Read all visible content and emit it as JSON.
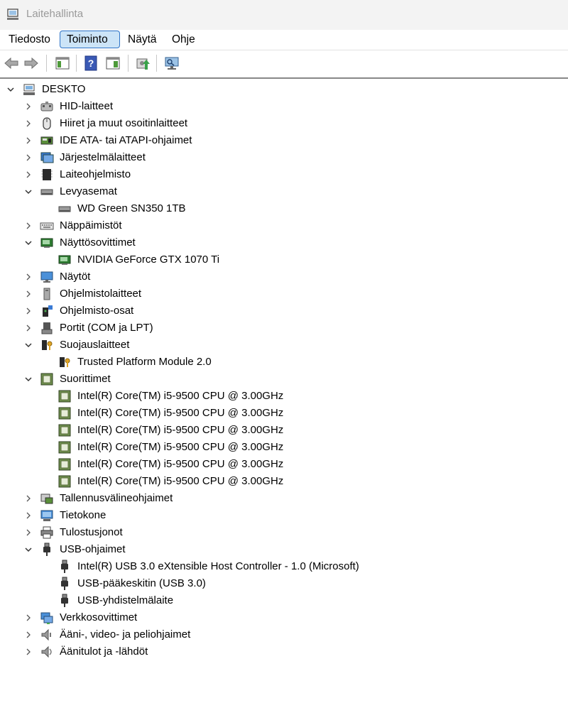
{
  "window": {
    "title": "Laitehallinta"
  },
  "menu": [
    {
      "label": "Tiedosto",
      "active": false
    },
    {
      "label": "Toiminto",
      "active": true
    },
    {
      "label": "Näytä",
      "active": false
    },
    {
      "label": "Ohje",
      "active": false
    }
  ],
  "toolbar": [
    {
      "name": "back-button",
      "icon": "arrow-left-icon"
    },
    {
      "name": "forward-button",
      "icon": "arrow-right-icon"
    },
    {
      "name": "show-hide-console-tree-button",
      "icon": "console-tree-icon"
    },
    {
      "name": "help-button",
      "icon": "help-icon"
    },
    {
      "name": "properties-button",
      "icon": "properties-icon"
    },
    {
      "name": "update-driver-button",
      "icon": "update-driver-icon"
    },
    {
      "name": "scan-hardware-button",
      "icon": "scan-monitor-icon"
    }
  ],
  "tree": {
    "root": {
      "label": "DESKTOP",
      "expanded": true
    },
    "items": [
      {
        "label": "HID-laitteet",
        "level": 1,
        "expanded": false,
        "icon": "hid-icon"
      },
      {
        "label": "Hiiret ja muut osoitinlaitteet",
        "level": 1,
        "expanded": false,
        "icon": "mouse-icon"
      },
      {
        "label": "IDE ATA- tai ATAPI-ohjaimet",
        "level": 1,
        "expanded": false,
        "icon": "ide-controller-icon"
      },
      {
        "label": "Järjestelmälaitteet",
        "level": 1,
        "expanded": false,
        "icon": "system-devices-icon"
      },
      {
        "label": "Laiteohjelmisto",
        "level": 1,
        "expanded": false,
        "icon": "firmware-icon"
      },
      {
        "label": "Levyasemat",
        "level": 1,
        "expanded": true,
        "icon": "disk-drive-icon"
      },
      {
        "label": "WD Green SN350 1TB",
        "level": 2,
        "icon": "disk-drive-icon"
      },
      {
        "label": "Näppäimistöt",
        "level": 1,
        "expanded": false,
        "icon": "keyboard-icon"
      },
      {
        "label": "Näyttösovittimet",
        "level": 1,
        "expanded": true,
        "icon": "display-adapter-icon"
      },
      {
        "label": "NVIDIA GeForce GTX 1070 Ti",
        "level": 2,
        "icon": "display-adapter-icon"
      },
      {
        "label": "Näytöt",
        "level": 1,
        "expanded": false,
        "icon": "monitor-icon"
      },
      {
        "label": "Ohjelmistolaitteet",
        "level": 1,
        "expanded": false,
        "icon": "software-device-icon"
      },
      {
        "label": "Ohjelmisto-osat",
        "level": 1,
        "expanded": false,
        "icon": "software-component-icon"
      },
      {
        "label": "Portit (COM ja LPT)",
        "level": 1,
        "expanded": false,
        "icon": "port-icon"
      },
      {
        "label": "Suojauslaitteet",
        "level": 1,
        "expanded": true,
        "icon": "security-device-icon"
      },
      {
        "label": "Trusted Platform Module 2.0",
        "level": 2,
        "icon": "security-device-icon"
      },
      {
        "label": "Suorittimet",
        "level": 1,
        "expanded": true,
        "icon": "processor-icon"
      },
      {
        "label": "Intel(R) Core(TM) i5-9500 CPU @ 3.00GHz",
        "level": 2,
        "icon": "processor-icon"
      },
      {
        "label": "Intel(R) Core(TM) i5-9500 CPU @ 3.00GHz",
        "level": 2,
        "icon": "processor-icon"
      },
      {
        "label": "Intel(R) Core(TM) i5-9500 CPU @ 3.00GHz",
        "level": 2,
        "icon": "processor-icon"
      },
      {
        "label": "Intel(R) Core(TM) i5-9500 CPU @ 3.00GHz",
        "level": 2,
        "icon": "processor-icon"
      },
      {
        "label": "Intel(R) Core(TM) i5-9500 CPU @ 3.00GHz",
        "level": 2,
        "icon": "processor-icon"
      },
      {
        "label": "Intel(R) Core(TM) i5-9500 CPU @ 3.00GHz",
        "level": 2,
        "icon": "processor-icon"
      },
      {
        "label": "Tallennusvälineohjaimet",
        "level": 1,
        "expanded": false,
        "icon": "storage-controller-icon"
      },
      {
        "label": "Tietokone",
        "level": 1,
        "expanded": false,
        "icon": "computer-icon"
      },
      {
        "label": "Tulostusjonot",
        "level": 1,
        "expanded": false,
        "icon": "printer-icon"
      },
      {
        "label": "USB-ohjaimet",
        "level": 1,
        "expanded": true,
        "icon": "usb-icon"
      },
      {
        "label": "Intel(R) USB 3.0 eXtensible Host Controller - 1.0 (Microsoft)",
        "level": 2,
        "icon": "usb-icon"
      },
      {
        "label": "USB-pääkeskitin (USB 3.0)",
        "level": 2,
        "icon": "usb-icon"
      },
      {
        "label": "USB-yhdistelmälaite",
        "level": 2,
        "icon": "usb-icon"
      },
      {
        "label": "Verkkosovittimet",
        "level": 1,
        "expanded": false,
        "icon": "network-adapter-icon"
      },
      {
        "label": "Ääni-, video- ja peliohjaimet",
        "level": 1,
        "expanded": false,
        "icon": "audio-icon"
      },
      {
        "label": "Äänitulot ja -lähdöt",
        "level": 1,
        "expanded": false,
        "icon": "audio-io-icon"
      }
    ]
  }
}
